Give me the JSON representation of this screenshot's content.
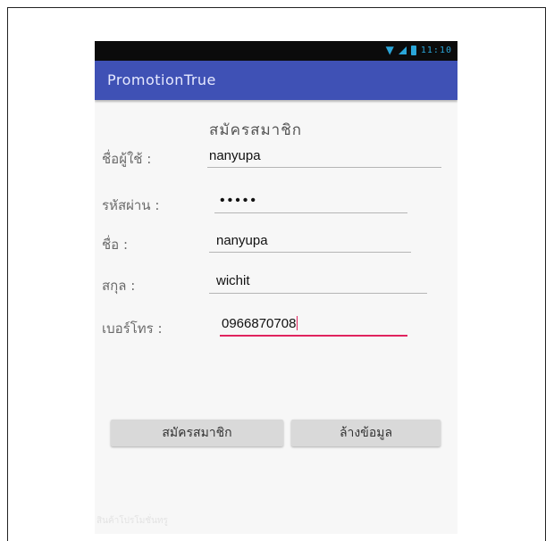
{
  "status_bar": {
    "time": "11:10"
  },
  "app_bar": {
    "title": "PromotionTrue"
  },
  "form": {
    "title": "สมัครสมาชิก",
    "fields": [
      {
        "label": "ชื่อผู้ใช้ :",
        "value": "nanyupa"
      },
      {
        "label": "รหัสผ่าน :",
        "value": "•••••"
      },
      {
        "label": "ชื่อ :",
        "value": "nanyupa"
      },
      {
        "label": "สกุล :",
        "value": "wichit"
      },
      {
        "label": "เบอร์โทร :",
        "value": "0966870708"
      }
    ]
  },
  "buttons": {
    "register_label": "สมัครสมาชิก",
    "clear_label": "ล้างข้อมูล"
  },
  "footer": {
    "note": "สินค้าโปรโมชั่นทรู"
  },
  "colors": {
    "app_bar": "#3f51b5",
    "status_bar": "#0b0b0b",
    "focus_underline": "#e0245e"
  }
}
